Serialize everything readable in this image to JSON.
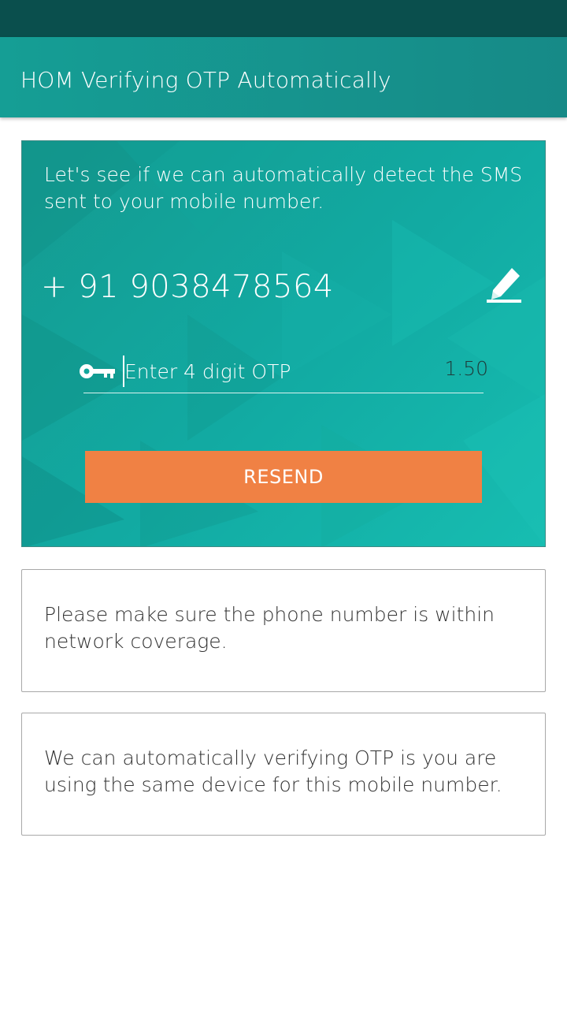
{
  "status_bar": {
    "color": "#0a4f4d"
  },
  "app_bar": {
    "title": "HOM Verifying OTP Automatically",
    "color": "#168e89"
  },
  "hero": {
    "description": "Let's see if we can automatically detect the SMS sent to your mobile number.",
    "phone_number": "+ 91 9038478564",
    "edit_icon": "pencil-edit-icon",
    "otp": {
      "key_icon": "key-icon",
      "value": "",
      "placeholder": "Enter 4 digit OTP",
      "timer": "1.50"
    },
    "resend_label": "RESEND",
    "resend_color": "#f08144"
  },
  "notes": [
    {
      "text": "Please make sure the phone number is within network coverage."
    },
    {
      "text": "We can automatically verifying OTP is you are using the same device for this mobile number."
    }
  ]
}
